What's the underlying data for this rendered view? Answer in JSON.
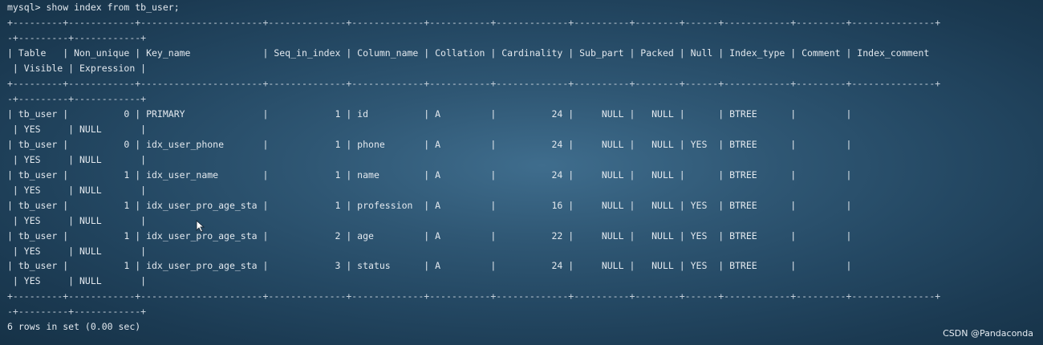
{
  "terminal": {
    "command_line": "mysql> show index from tb_user;",
    "border_line_1": "+---------+------------+----------------------+--------------+-------------+-----------+-------------+----------+--------+------+------------+---------+---------------+",
    "border_line_2": "-+---------+------------+",
    "header_line_1": "| Table   | Non_unique | Key_name             | Seq_in_index | Column_name | Collation | Cardinality | Sub_part | Packed | Null | Index_type | Comment | Index_comment",
    "header_line_2": " | Visible | Expression |",
    "rows": [
      {
        "line_1": "| tb_user |          0 | PRIMARY              |            1 | id          | A         |          24 |     NULL |   NULL |      | BTREE      |         |",
        "line_2": " | YES     | NULL       |"
      },
      {
        "line_1": "| tb_user |          0 | idx_user_phone       |            1 | phone       | A         |          24 |     NULL |   NULL | YES  | BTREE      |         |",
        "line_2": " | YES     | NULL       |"
      },
      {
        "line_1": "| tb_user |          1 | idx_user_name        |            1 | name        | A         |          24 |     NULL |   NULL |      | BTREE      |         |",
        "line_2": " | YES     | NULL       |"
      },
      {
        "line_1": "| tb_user |          1 | idx_user_pro_age_sta |            1 | profession  | A         |          16 |     NULL |   NULL | YES  | BTREE      |         |",
        "line_2": " | YES     | NULL       |"
      },
      {
        "line_1": "| tb_user |          1 | idx_user_pro_age_sta |            2 | age         | A         |          22 |     NULL |   NULL | YES  | BTREE      |         |",
        "line_2": " | YES     | NULL       |"
      },
      {
        "line_1": "| tb_user |          1 | idx_user_pro_age_sta |            3 | status      | A         |          24 |     NULL |   NULL | YES  | BTREE      |         |",
        "line_2": " | YES     | NULL       |"
      }
    ],
    "result_summary": "6 rows in set (0.00 sec)"
  },
  "watermark": "CSDN @Pandaconda",
  "colors": {
    "text": "#e2e8ee",
    "background_center": "#3f6d8d",
    "background_edge": "#163247"
  },
  "icons": {
    "mouse_cursor": "arrow-cursor-icon"
  }
}
